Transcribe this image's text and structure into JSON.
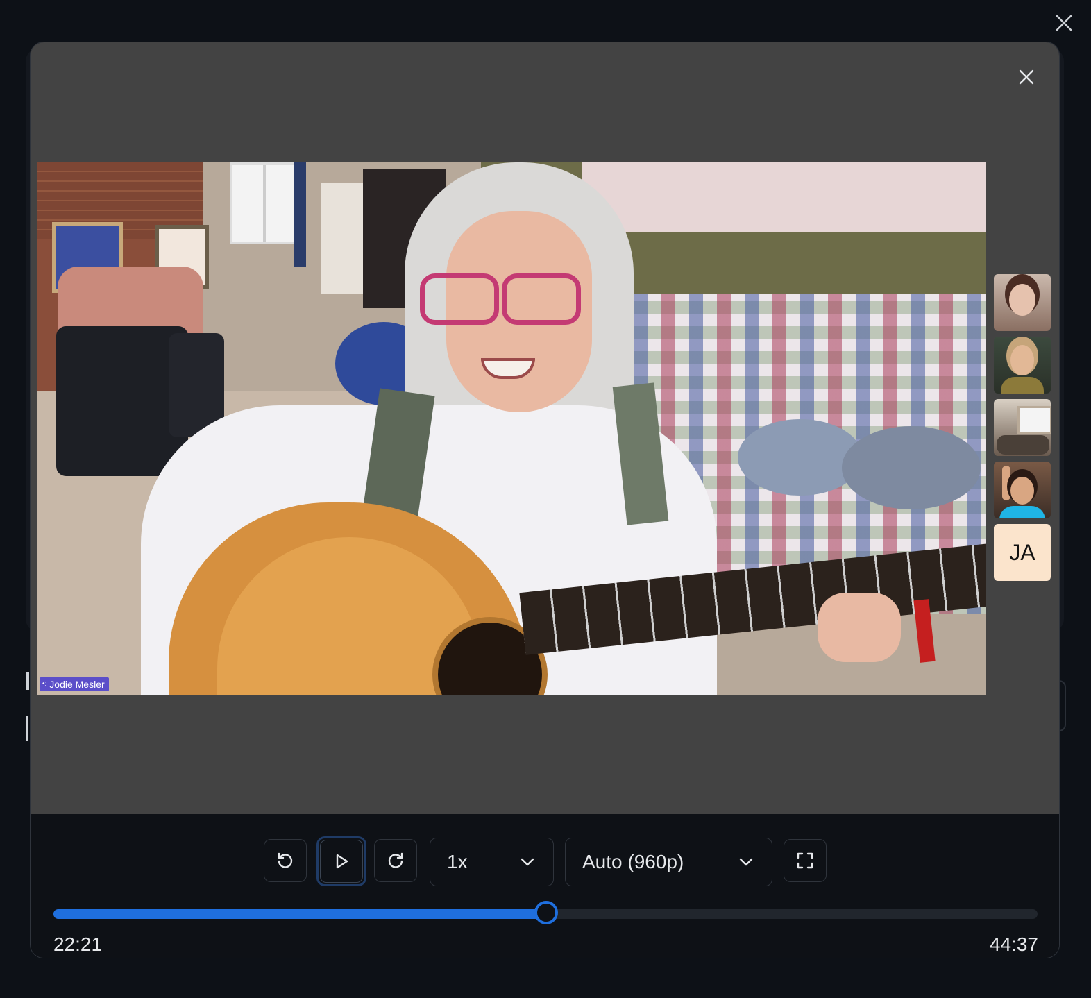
{
  "overlay": {
    "close_icon": "close-icon"
  },
  "player": {
    "close_icon": "close-icon",
    "video": {
      "speaker_name": "Jodie Mesler"
    },
    "participants": [
      {
        "kind": "video",
        "label": ""
      },
      {
        "kind": "video",
        "label": ""
      },
      {
        "kind": "video",
        "label": ""
      },
      {
        "kind": "video",
        "label": ""
      },
      {
        "kind": "initials",
        "label": "JA"
      }
    ],
    "controls": {
      "rewind_icon": "rotate-ccw-icon",
      "play_icon": "play-icon",
      "forward_icon": "rotate-cw-icon",
      "speed": "1x",
      "quality": "Auto (960p)",
      "fullscreen_icon": "fullscreen-icon",
      "dropdown_icon": "chevron-down-icon"
    },
    "progress": {
      "fraction": 0.501,
      "current_time": "22:21",
      "total_time": "44:37"
    },
    "colors": {
      "accent": "#1f6fde",
      "stage_bg": "#434343",
      "page_bg": "#0d1117",
      "name_tag_bg": "#5b4ec9",
      "initials_bg": "#fbe4cc"
    }
  }
}
